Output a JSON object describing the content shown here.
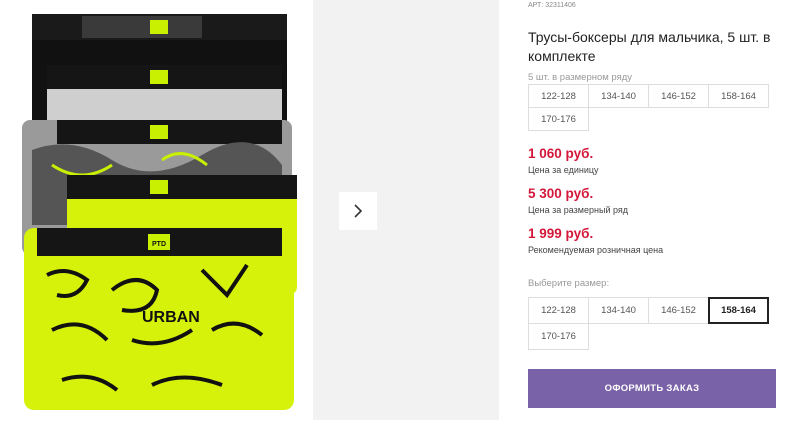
{
  "product": {
    "article_label": "АРТ:",
    "article_number": "32311406",
    "title": "Трусы-боксеры для мальчика, 5 шт. в комплекте",
    "image_icon": "boxer-briefs-photo",
    "brand_tag": "PTD"
  },
  "gallery": {
    "next_icon": "chevron-right-icon"
  },
  "set_sizes": {
    "label": "5 шт. в размерном ряду",
    "items": [
      "122-128",
      "134-140",
      "146-152",
      "158-164",
      "170-176"
    ]
  },
  "prices": [
    {
      "value": "1 060 руб.",
      "caption": "Цена за единицу"
    },
    {
      "value": "5 300 руб.",
      "caption": "Цена за размерный ряд"
    },
    {
      "value": "1 999 руб.",
      "caption": "Рекомендуемая розничная цена"
    }
  ],
  "size_select": {
    "label": "Выберите размер:",
    "options": [
      "122-128",
      "134-140",
      "146-152",
      "158-164",
      "170-176"
    ],
    "selected": "158-164"
  },
  "order_button": {
    "label": "ОФОРМИТЬ ЗАКАЗ"
  },
  "colors": {
    "price": "#d4183a",
    "accent": "#7a62a8",
    "neon": "#d7f20a"
  }
}
